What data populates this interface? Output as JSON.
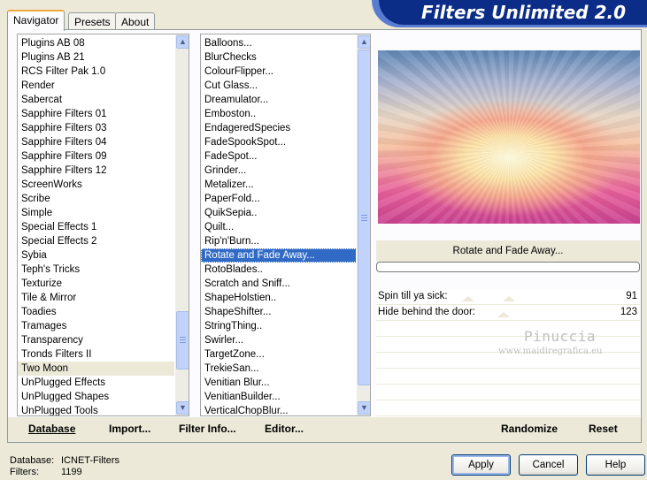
{
  "title": "Filters Unlimited 2.0",
  "tabs": [
    "Navigator",
    "Presets",
    "About"
  ],
  "categories": [
    "Plugins AB 08",
    "Plugins AB 21",
    "RCS Filter Pak 1.0",
    "Render",
    "Sabercat",
    "Sapphire Filters 01",
    "Sapphire Filters 03",
    "Sapphire Filters 04",
    "Sapphire Filters 09",
    "Sapphire Filters 12",
    "ScreenWorks",
    "Scribe",
    "Simple",
    "Special Effects 1",
    "Special Effects 2",
    "Sybia",
    "Teph's Tricks",
    "Texturize",
    "Tile & Mirror",
    "Toadies",
    "Tramages",
    "Transparency",
    "Tronds Filters II",
    "Two Moon",
    "UnPlugged Effects",
    "UnPlugged Shapes",
    "UnPlugged Tools"
  ],
  "filters": [
    "Balloons...",
    "BlurChecks",
    "ColourFlipper...",
    "Cut Glass...",
    "Dreamulator...",
    "Emboston..",
    "EndageredSpecies",
    "FadeSpookSpot...",
    "FadeSpot...",
    "Grinder...",
    "Metalizer...",
    "PaperFold...",
    "QuikSepia..",
    "Quilt...",
    "Rip'n'Burn...",
    "Rotate and Fade Away...",
    "RotoBlades..",
    "Scratch and Sniff...",
    "ShapeHolstien..",
    "ShapeShifter...",
    "StringThing..",
    "Swirler...",
    "TargetZone...",
    "TrekieSan...",
    "Venitian Blur...",
    "VenitianBuilder...",
    "VerticalChopBlur..."
  ],
  "selected_filter_name": "Rotate and Fade Away...",
  "params": [
    {
      "label": "Spin till ya sick:",
      "value": "91"
    },
    {
      "label": "Hide behind the door:",
      "value": "123"
    }
  ],
  "watermark": {
    "name": "Pinuccia",
    "site": "www.maidiregrafica.eu"
  },
  "toolbar": {
    "database": "Database",
    "import": "Import...",
    "filter_info": "Filter Info...",
    "editor": "Editor...",
    "randomize": "Randomize",
    "reset": "Reset"
  },
  "status": {
    "database_label": "Database:",
    "database_value": "ICNET-Filters",
    "filters_label": "Filters:",
    "filters_value": "1199"
  },
  "buttons": {
    "apply": "Apply",
    "cancel": "Cancel",
    "help": "Help"
  },
  "icons": {
    "scroll_up": "chevron-up-icon",
    "scroll_down": "chevron-down-icon"
  }
}
